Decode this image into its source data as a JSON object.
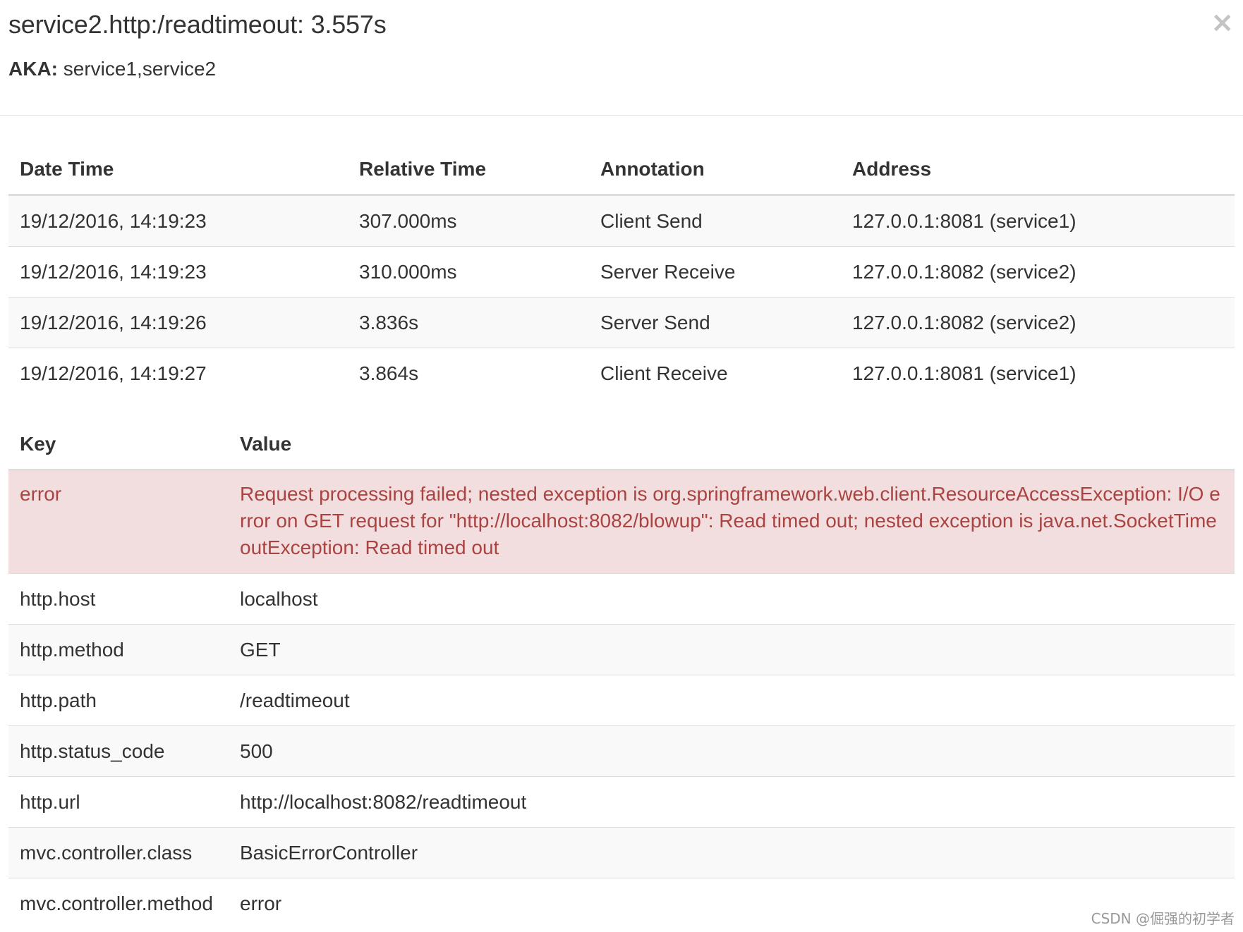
{
  "header": {
    "title": "service2.http:/readtimeout: 3.557s",
    "aka_label": "AKA:",
    "aka_value": "service1,service2",
    "close_label": "×"
  },
  "annotations": {
    "headers": [
      "Date Time",
      "Relative Time",
      "Annotation",
      "Address"
    ],
    "rows": [
      [
        "19/12/2016, 14:19:23",
        "307.000ms",
        "Client Send",
        "127.0.0.1:8081 (service1)"
      ],
      [
        "19/12/2016, 14:19:23",
        "310.000ms",
        "Server Receive",
        "127.0.0.1:8082 (service2)"
      ],
      [
        "19/12/2016, 14:19:26",
        "3.836s",
        "Server Send",
        "127.0.0.1:8082 (service2)"
      ],
      [
        "19/12/2016, 14:19:27",
        "3.864s",
        "Client Receive",
        "127.0.0.1:8081 (service1)"
      ]
    ]
  },
  "tags": {
    "headers": [
      "Key",
      "Value"
    ],
    "error": {
      "key": "error",
      "value": "Request processing failed; nested exception is org.springframework.web.client.ResourceAccessException: I/O error on GET request for \"http://localhost:8082/blowup\": Read timed out; nested exception is java.net.SocketTimeoutException: Read timed out"
    },
    "rows": [
      [
        "http.host",
        "localhost"
      ],
      [
        "http.method",
        "GET"
      ],
      [
        "http.path",
        "/readtimeout"
      ],
      [
        "http.status_code",
        "500"
      ],
      [
        "http.url",
        "http://localhost:8082/readtimeout"
      ],
      [
        "mvc.controller.class",
        "BasicErrorController"
      ],
      [
        "mvc.controller.method",
        "error"
      ]
    ]
  },
  "watermark": "CSDN @倔强的初学者",
  "colors": {
    "error_bg": "#f2dede",
    "error_text": "#a94442",
    "stripe": "#f9f9f9",
    "border": "#dddddd"
  }
}
